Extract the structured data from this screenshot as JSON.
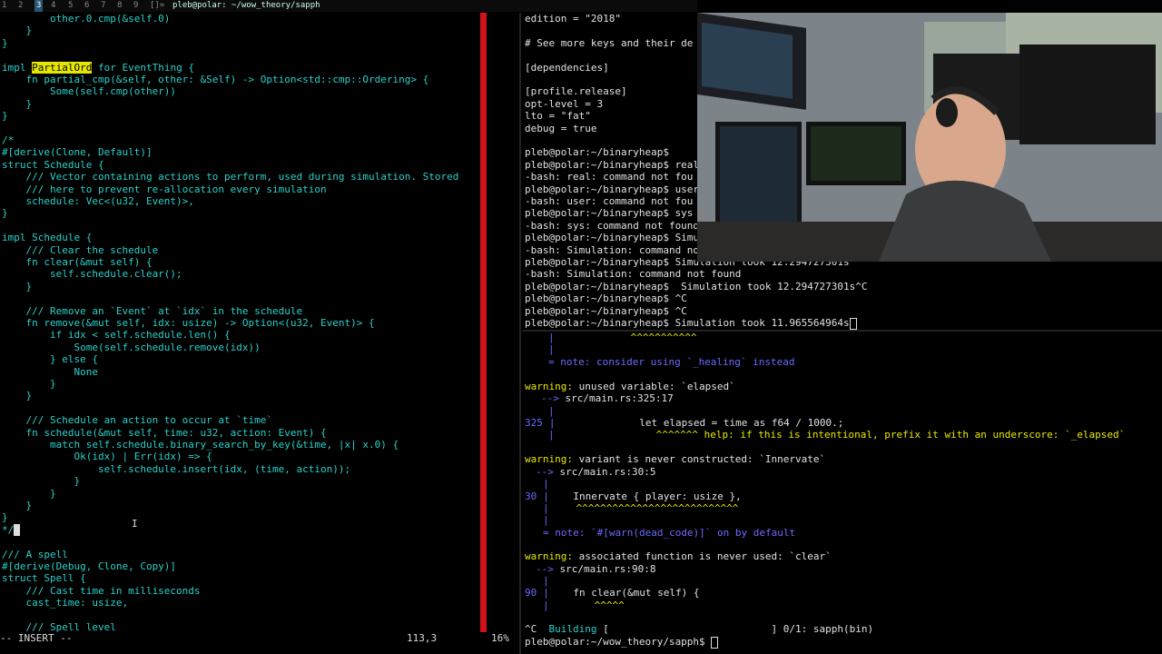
{
  "topbar": {
    "workspaces": [
      "1",
      "2",
      "3",
      "4",
      "5",
      "6",
      "7",
      "8",
      "9",
      "[]="
    ],
    "active_workspace": "3",
    "window_title": "pleb@polar: ~/wow_theory/sapph"
  },
  "editor": {
    "lines": [
      {
        "t": "        other.0.cmp(&self.0)"
      },
      {
        "t": "    }"
      },
      {
        "t": "}"
      },
      {
        "t": ""
      },
      {
        "pre": "impl ",
        "hl": "PartialOrd",
        "post": " for EventThing {"
      },
      {
        "t": "    fn partial_cmp(&self, other: &Self) -> Option<std::cmp::Ordering> {"
      },
      {
        "t": "        Some(self.cmp(other))"
      },
      {
        "t": "    }"
      },
      {
        "t": "}"
      },
      {
        "t": ""
      },
      {
        "t": "/*"
      },
      {
        "t": "#[derive(Clone, Default)]"
      },
      {
        "t": "struct Schedule {"
      },
      {
        "t": "    /// Vector containing actions to perform, used during simulation. Stored"
      },
      {
        "t": "    /// here to prevent re-allocation every simulation"
      },
      {
        "t": "    schedule: Vec<(u32, Event)>,"
      },
      {
        "t": "}"
      },
      {
        "t": ""
      },
      {
        "t": "impl Schedule {"
      },
      {
        "t": "    /// Clear the schedule"
      },
      {
        "t": "    fn clear(&mut self) {"
      },
      {
        "t": "        self.schedule.clear();"
      },
      {
        "t": "    }"
      },
      {
        "t": ""
      },
      {
        "t": "    /// Remove an `Event` at `idx` in the schedule"
      },
      {
        "t": "    fn remove(&mut self, idx: usize) -> Option<(u32, Event)> {"
      },
      {
        "t": "        if idx < self.schedule.len() {"
      },
      {
        "t": "            Some(self.schedule.remove(idx))"
      },
      {
        "t": "        } else {"
      },
      {
        "t": "            None"
      },
      {
        "t": "        }"
      },
      {
        "t": "    }"
      },
      {
        "t": ""
      },
      {
        "t": "    /// Schedule an action to occur at `time`"
      },
      {
        "t": "    fn schedule(&mut self, time: u32, action: Event) {"
      },
      {
        "t": "        match self.schedule.binary_search_by_key(&time, |x| x.0) {"
      },
      {
        "t": "            Ok(idx) | Err(idx) => {"
      },
      {
        "t": "                self.schedule.insert(idx, (time, action));"
      },
      {
        "t": "            }"
      },
      {
        "t": "        }"
      },
      {
        "t": "    }"
      },
      {
        "t": "}"
      },
      {
        "t": "*/",
        "cursor": true
      },
      {
        "t": ""
      },
      {
        "t": "/// A spell"
      },
      {
        "t": "#[derive(Debug, Clone, Copy)]"
      },
      {
        "t": "struct Spell {"
      },
      {
        "t": "    /// Cast time in milliseconds"
      },
      {
        "t": "    cast_time: usize,"
      },
      {
        "t": ""
      },
      {
        "t": "    /// Spell level"
      }
    ],
    "mode": "-- INSERT --",
    "position": "113,3",
    "percent": "16%"
  },
  "term1": {
    "lines": [
      "edition = \"2018\"",
      "",
      "# See more keys and their de",
      "",
      "[dependencies]",
      "",
      "[profile.release]",
      "opt-level = 3",
      "lto = \"fat\"",
      "debug = true",
      "",
      "pleb@polar:~/binaryheap$",
      "pleb@polar:~/binaryheap$ real",
      "-bash: real: command not fou",
      "pleb@polar:~/binaryheap$ user",
      "-bash: user: command not fou",
      "pleb@polar:~/binaryheap$ sys",
      "-bash: sys: command not found",
      "pleb@polar:~/binaryheap$ Simu",
      "-bash: Simulation: command no",
      "pleb@polar:~/binaryheap$ Simulation took 12.294727301s",
      "-bash: Simulation: command not found",
      "pleb@polar:~/binaryheap$  Simulation took 12.294727301s^C",
      "pleb@polar:~/binaryheap$ ^C",
      "pleb@polar:~/binaryheap$ ^C",
      "pleb@polar:~/binaryheap$ Simulation took 11.965564964s"
    ]
  },
  "term2": {
    "carets1": "^^^^^^^^^^^",
    "pipe": "|",
    "note_healing": "= note: consider using `_healing` instead",
    "warn1_label": "warning:",
    "warn1_text": " unused variable: `elapsed`",
    "warn1_arrow": "-->",
    "warn1_loc": " src/main.rs:325:17",
    "line325_num": "325",
    "line325_code": "              let elapsed = time as f64 / 1000.;",
    "help_carets": "^^^^^^^",
    "help_text": " help: if this is intentional, prefix it with an underscore: `_elapsed`",
    "warn2_label": "warning:",
    "warn2_text": " variant is never constructed: `Innervate`",
    "warn2_arrow": "-->",
    "warn2_loc": " src/main.rs:30:5",
    "line30_num": "30",
    "line30_code": "    Innervate { player: usize },",
    "carets30": "^^^^^^^^^^^^^^^^^^^^^^^^^^^",
    "note_deadcode": "= note: `#[warn(dead_code)]` on by default",
    "warn3_label": "warning:",
    "warn3_text": " associated function is never used: `clear`",
    "warn3_arrow": "-->",
    "warn3_loc": " src/main.rs:90:8",
    "line90_num": "90",
    "line90_code": "    fn clear(&mut self) {",
    "carets90": "^^^^^",
    "building_pre": "^C  ",
    "building_label": "Building",
    "building_bar": " [                           ]",
    "building_progress": " 0/1: sapph(bin)",
    "prompt": "pleb@polar:~/wow_theory/sapph$ "
  },
  "colors": {
    "code": "#2ad1c9",
    "warning": "#e8e800",
    "gutter": "#6a6aff",
    "cursor_line_bar": "#d0121b"
  }
}
